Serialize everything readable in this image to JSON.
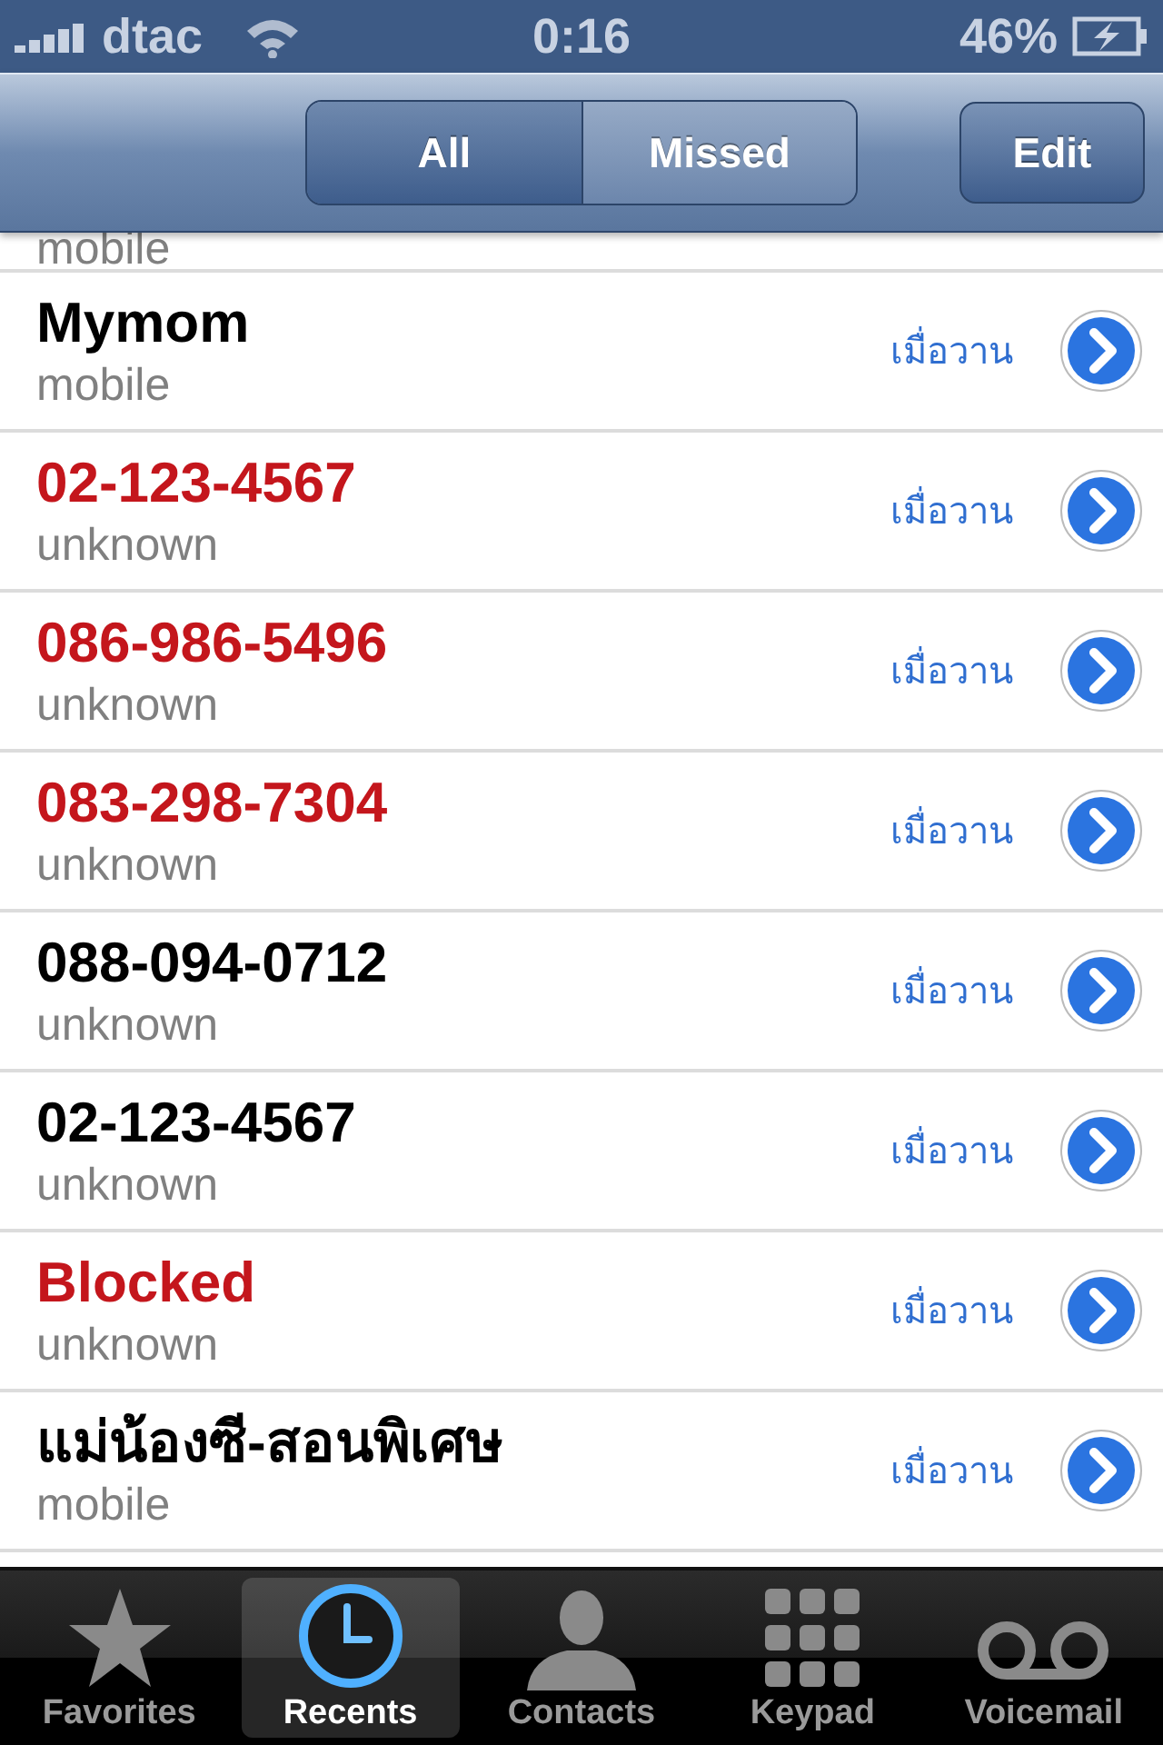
{
  "status_bar": {
    "carrier": "dtac",
    "time": "0:16",
    "battery": "46%"
  },
  "segments": [
    {
      "label": "All",
      "selected": true
    },
    {
      "label": "Missed",
      "selected": false
    }
  ],
  "edit_button": "Edit",
  "partial_row": {
    "type": "mobile"
  },
  "calls": [
    {
      "name": "Mymom",
      "type": "mobile",
      "date": "เมื่อวาน",
      "missed": false
    },
    {
      "name": "02-123-4567",
      "type": "unknown",
      "date": "เมื่อวาน",
      "missed": true
    },
    {
      "name": "086-986-5496",
      "type": "unknown",
      "date": "เมื่อวาน",
      "missed": true
    },
    {
      "name": "083-298-7304",
      "type": "unknown",
      "date": "เมื่อวาน",
      "missed": true
    },
    {
      "name": "088-094-0712",
      "type": "unknown",
      "date": "เมื่อวาน",
      "missed": false
    },
    {
      "name": "02-123-4567",
      "type": "unknown",
      "date": "เมื่อวาน",
      "missed": false
    },
    {
      "name": "Blocked",
      "type": "unknown",
      "date": "เมื่อวาน",
      "missed": true
    },
    {
      "name": "แม่น้องซี-สอนพิเศษ",
      "type": "mobile",
      "date": "เมื่อวาน",
      "missed": false
    }
  ],
  "tabs": [
    {
      "label": "Favorites",
      "kind": "star",
      "selected": false
    },
    {
      "label": "Recents",
      "kind": "clock",
      "selected": true
    },
    {
      "label": "Contacts",
      "kind": "person",
      "selected": false
    },
    {
      "label": "Keypad",
      "kind": "keypad",
      "selected": false
    },
    {
      "label": "Voicemail",
      "kind": "voicemail",
      "selected": false
    }
  ]
}
